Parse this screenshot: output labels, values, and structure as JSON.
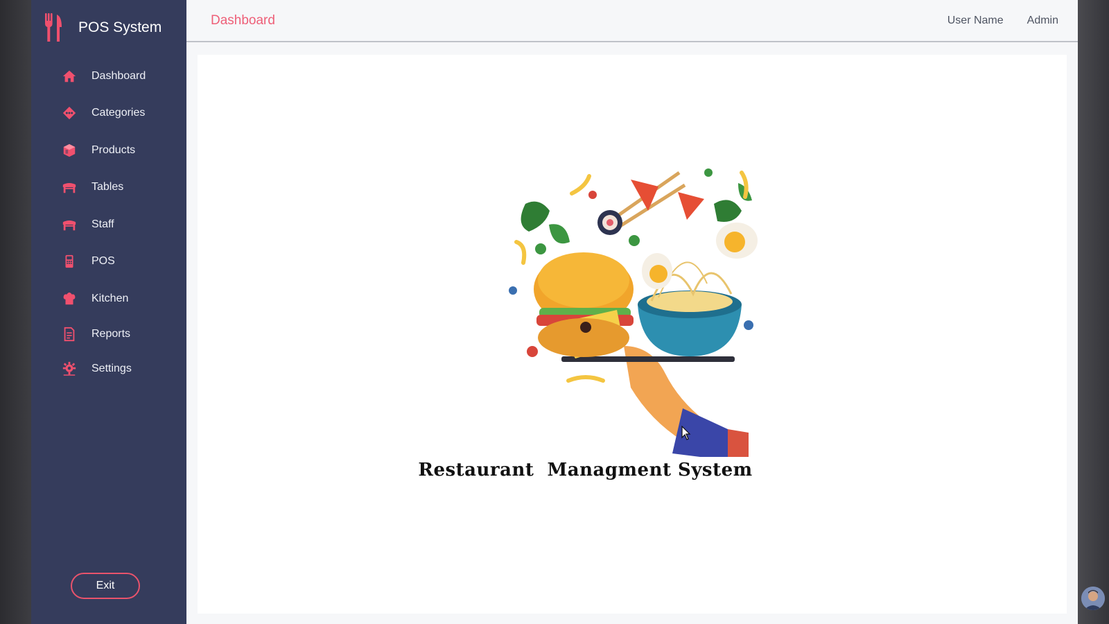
{
  "brand": {
    "title": "POS System",
    "icon": "utensils-icon"
  },
  "sidebar": {
    "items": [
      {
        "label": "Dashboard",
        "icon": "home-icon"
      },
      {
        "label": "Categories",
        "icon": "diamond-icon"
      },
      {
        "label": "Products",
        "icon": "box-icon"
      },
      {
        "label": "Tables",
        "icon": "table-icon"
      },
      {
        "label": "Staff",
        "icon": "staff-icon"
      },
      {
        "label": "POS",
        "icon": "pos-terminal-icon"
      },
      {
        "label": "Kitchen",
        "icon": "chef-hat-icon"
      },
      {
        "label": "Reports",
        "icon": "report-icon"
      },
      {
        "label": "Settings",
        "icon": "gear-icon"
      }
    ],
    "exit_label": "Exit"
  },
  "header": {
    "title": "Dashboard",
    "user_label": "User Name",
    "role": "Admin"
  },
  "main": {
    "app_title": "Restaurant  Managment System"
  },
  "colors": {
    "sidebar_bg": "#353c5c",
    "accent": "#ee5f78",
    "icon": "#f0506e"
  }
}
